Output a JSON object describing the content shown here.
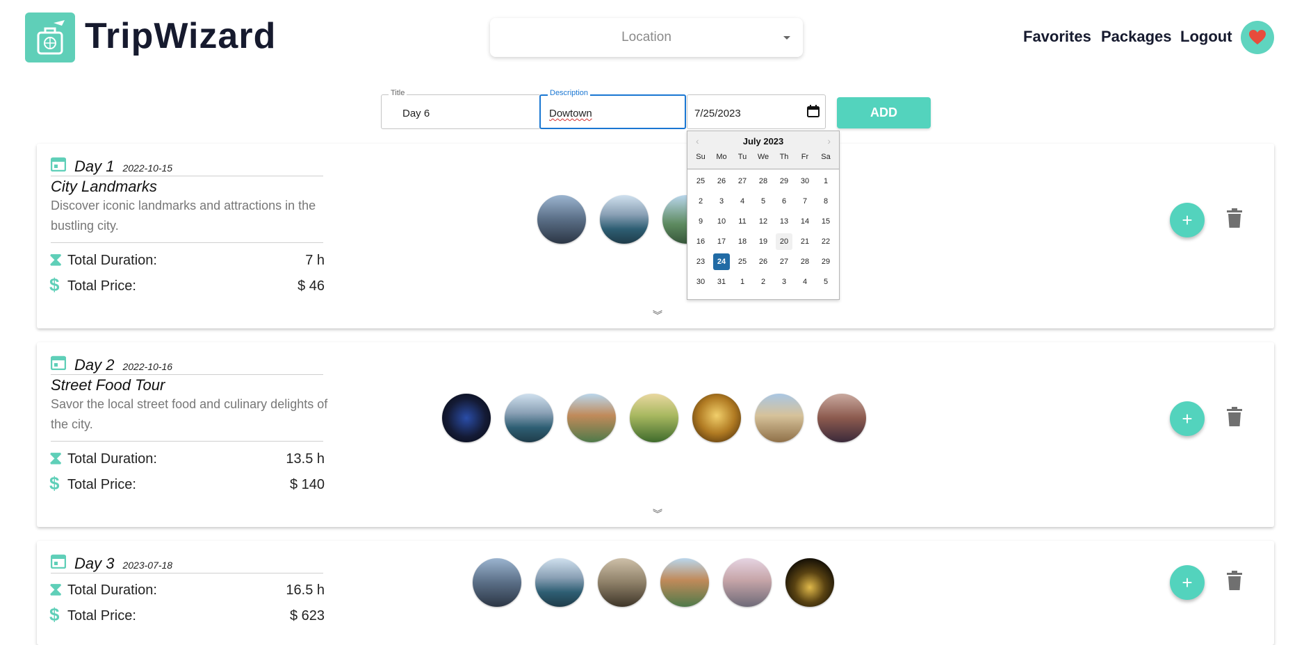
{
  "header": {
    "brand": "TripWizard",
    "location_placeholder": "Location",
    "nav": [
      "Favorites",
      "Packages",
      "Logout"
    ]
  },
  "form": {
    "title_label": "Title",
    "title_value": "Day 6",
    "description_label": "Description",
    "description_value": "Dowtown",
    "date_value": "7/25/2023",
    "add_label": "ADD"
  },
  "calendar": {
    "month": "July 2023",
    "weekdays": [
      "Su",
      "Mo",
      "Tu",
      "We",
      "Th",
      "Fr",
      "Sa"
    ],
    "days": [
      "25",
      "26",
      "27",
      "28",
      "29",
      "30",
      "1",
      "2",
      "3",
      "4",
      "5",
      "6",
      "7",
      "8",
      "9",
      "10",
      "11",
      "12",
      "13",
      "14",
      "15",
      "16",
      "17",
      "18",
      "19",
      "20",
      "21",
      "22",
      "23",
      "24",
      "25",
      "26",
      "27",
      "28",
      "29",
      "30",
      "31",
      "1",
      "2",
      "3",
      "4",
      "5"
    ],
    "selected": "25",
    "highlighted": "20"
  },
  "days": [
    {
      "title": "Day 1",
      "date": "2022-10-15",
      "activity": "City Landmarks",
      "description": "Discover iconic landmarks and attractions in the bustling city.",
      "duration_label": "Total Duration:",
      "duration": "7 h",
      "price_label": "Total Price:",
      "price": "$ 46"
    },
    {
      "title": "Day 2",
      "date": "2022-10-16",
      "activity": "Street Food Tour",
      "description": "Savor the local street food and culinary delights of the city.",
      "duration_label": "Total Duration:",
      "duration": "13.5 h",
      "price_label": "Total Price:",
      "price": "$ 140"
    },
    {
      "title": "Day 3",
      "date": "2023-07-18",
      "duration_label": "Total Duration:",
      "duration": "16.5 h",
      "price_label": "Total Price:",
      "price": "$ 623"
    }
  ],
  "colors": {
    "accent": "#53d3bd",
    "selected_day": "#216ba5",
    "heart": "#e74c3c"
  }
}
